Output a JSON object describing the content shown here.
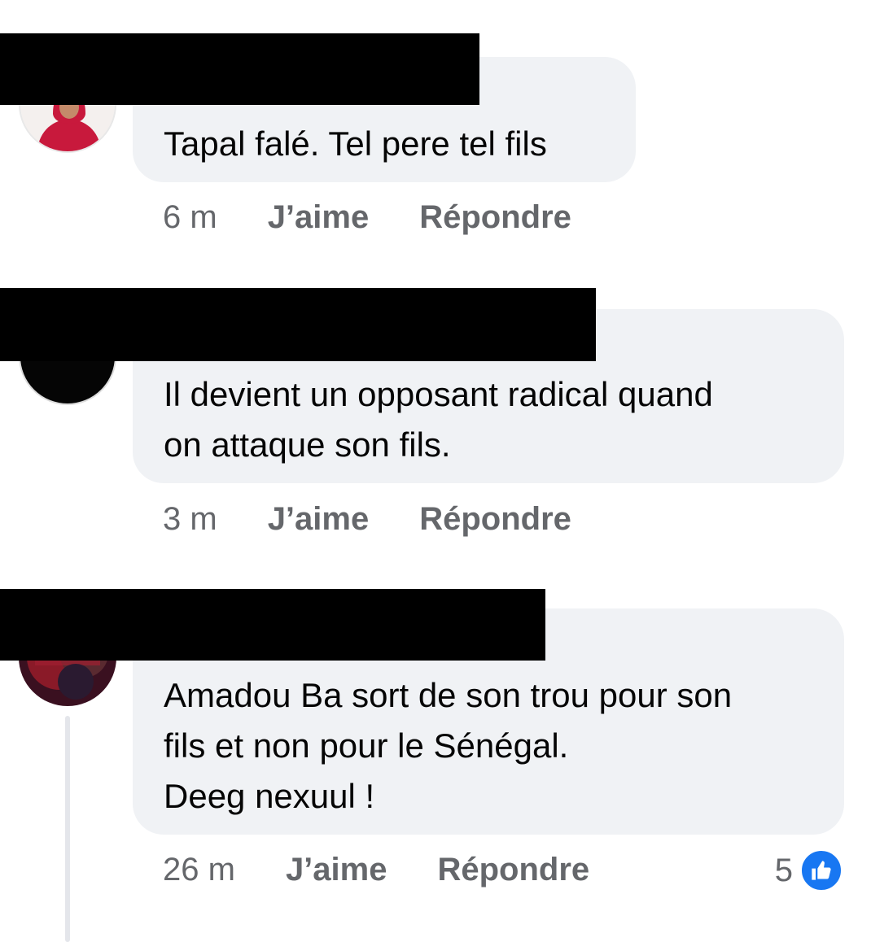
{
  "colors": {
    "bubble": "#f0f2f5",
    "meta": "#65676b",
    "like_blue": "#1877f2",
    "redaction": "#000000"
  },
  "comments": [
    {
      "text": "Tapal falé. Tel pere tel fils",
      "time": "6 m",
      "like_label": "J’aime",
      "reply_label": "Répondre"
    },
    {
      "text": "Il devient un opposant radical quand\non attaque son fils.",
      "time": "3 m",
      "like_label": "J’aime",
      "reply_label": "Répondre"
    },
    {
      "text": "Amadou Ba sort de son trou pour son\nfils et non pour le Sénégal.\nDeeg nexuul !",
      "time": "26 m",
      "like_label": "J’aime",
      "reply_label": "Répondre",
      "reaction_count": "5",
      "reaction_icon": "thumbs-up-icon"
    }
  ]
}
